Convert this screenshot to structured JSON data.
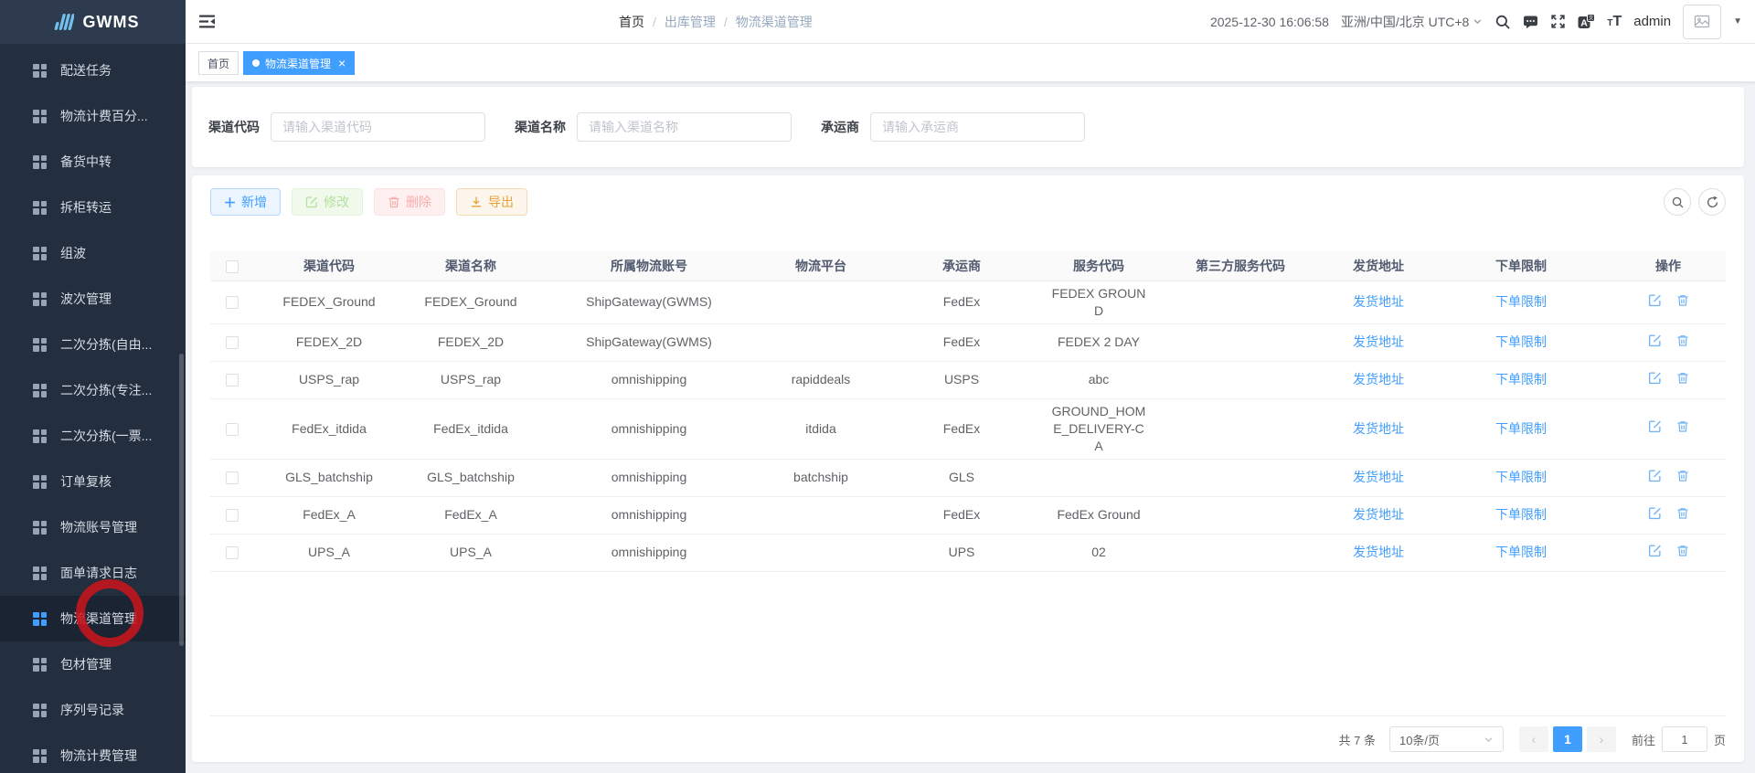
{
  "app": {
    "name": "GWMS"
  },
  "sidebar": {
    "items": [
      {
        "label": "配送任务"
      },
      {
        "label": "物流计费百分..."
      },
      {
        "label": "备货中转"
      },
      {
        "label": "拆柜转运"
      },
      {
        "label": "组波"
      },
      {
        "label": "波次管理"
      },
      {
        "label": "二次分拣(自由..."
      },
      {
        "label": "二次分拣(专注..."
      },
      {
        "label": "二次分拣(一票..."
      },
      {
        "label": "订单复核"
      },
      {
        "label": "物流账号管理"
      },
      {
        "label": "面单请求日志"
      },
      {
        "label": "物流渠道管理",
        "active": true
      },
      {
        "label": "包材管理"
      },
      {
        "label": "序列号记录"
      },
      {
        "label": "物流计费管理"
      }
    ]
  },
  "header": {
    "breadcrumb": {
      "home": "首页",
      "section": "出库管理",
      "current": "物流渠道管理"
    },
    "datetime": "2025-12-30 16:06:58",
    "timezone": "亚洲/中国/北京 UTC+8",
    "username": "admin"
  },
  "tabs": {
    "home": "首页",
    "current": "物流渠道管理"
  },
  "search": {
    "fields": [
      {
        "label": "渠道代码",
        "placeholder": "请输入渠道代码"
      },
      {
        "label": "渠道名称",
        "placeholder": "请输入渠道名称"
      },
      {
        "label": "承运商",
        "placeholder": "请输入承运商"
      }
    ],
    "search_label": "搜索",
    "reset_label": "重置"
  },
  "toolbar": {
    "add": "新增",
    "edit": "修改",
    "delete": "删除",
    "export": "导出"
  },
  "table": {
    "columns": [
      "渠道代码",
      "渠道名称",
      "所属物流账号",
      "物流平台",
      "承运商",
      "服务代码",
      "第三方服务代码",
      "发货地址",
      "下单限制",
      "操作"
    ],
    "address_link": "发货地址",
    "limit_link": "下单限制",
    "rows": [
      {
        "code": "FEDEX_Ground",
        "name": "FEDEX_Ground",
        "account": "ShipGateway(GWMS)",
        "platform": "",
        "carrier": "FedEx",
        "service": "FEDEX GROUND",
        "third_party": ""
      },
      {
        "code": "FEDEX_2D",
        "name": "FEDEX_2D",
        "account": "ShipGateway(GWMS)",
        "platform": "",
        "carrier": "FedEx",
        "service": "FEDEX 2 DAY",
        "third_party": ""
      },
      {
        "code": "USPS_rap",
        "name": "USPS_rap",
        "account": "omnishipping",
        "platform": "rapiddeals",
        "carrier": "USPS",
        "service": "abc",
        "third_party": ""
      },
      {
        "code": "FedEx_itdida",
        "name": "FedEx_itdida",
        "account": "omnishipping",
        "platform": "itdida",
        "carrier": "FedEx",
        "service": "GROUND_HOME_DELIVERY-CA",
        "third_party": ""
      },
      {
        "code": "GLS_batchship",
        "name": "GLS_batchship",
        "account": "omnishipping",
        "platform": "batchship",
        "carrier": "GLS",
        "service": "",
        "third_party": ""
      },
      {
        "code": "FedEx_A",
        "name": "FedEx_A",
        "account": "omnishipping",
        "platform": "",
        "carrier": "FedEx",
        "service": "FedEx Ground",
        "third_party": ""
      },
      {
        "code": "UPS_A",
        "name": "UPS_A",
        "account": "omnishipping",
        "platform": "",
        "carrier": "UPS",
        "service": "02",
        "third_party": ""
      }
    ]
  },
  "pagination": {
    "total": "共 7 条",
    "page_size": "10条/页",
    "prev": "‹",
    "page": "1",
    "next": "›",
    "goto": "前往",
    "goto_value": "1",
    "unit": "页"
  },
  "colors": {
    "primary": "#409eff",
    "annotation": "#cd141c",
    "sidebar_bg": "#232e3f"
  }
}
